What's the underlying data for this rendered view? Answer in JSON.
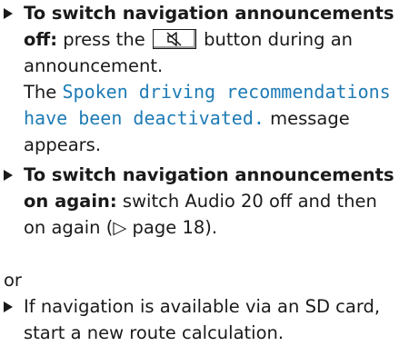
{
  "steps": [
    {
      "lead": "To switch navigation announcements off:",
      "text_before_button": "press the",
      "button_icon": "speaker-mute-icon",
      "text_after_button": "button during an announcement.",
      "message_prefix": "The",
      "message": "Spoken driving recommendations have been deactivated.",
      "message_suffix": "message appears."
    },
    {
      "lead": "To switch navigation announcements on again:",
      "text": "switch Audio 20 off and then on again (▷ page 18)."
    },
    {
      "text": "If navigation is available via an SD card, start a new route calculation."
    }
  ],
  "or_label": "or",
  "colors": {
    "text": "#1a1a1a",
    "display_message": "#1e7bb5"
  }
}
